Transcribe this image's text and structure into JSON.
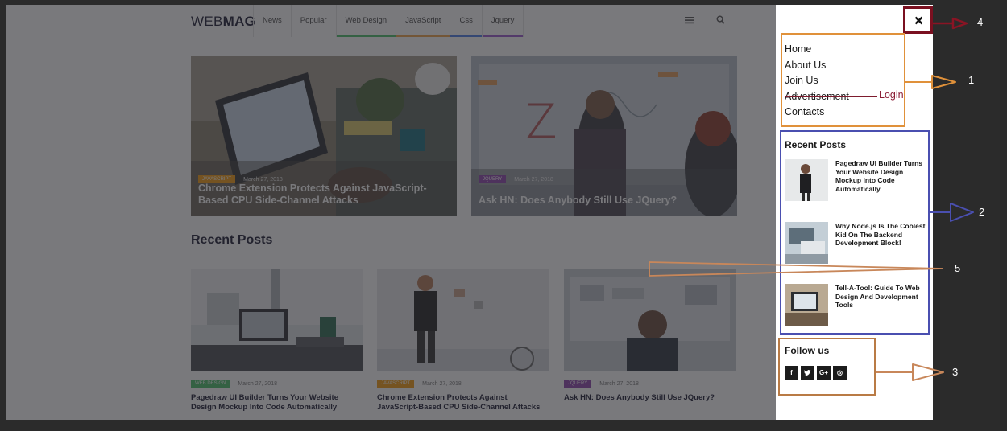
{
  "header": {
    "logo_regular": "WEB",
    "logo_bold": "MAG",
    "nav": [
      {
        "label": "News",
        "color": ""
      },
      {
        "label": "Popular",
        "color": ""
      },
      {
        "label": "Web Design",
        "color": "#4bbf6b"
      },
      {
        "label": "JavaScript",
        "color": "#f0a44a"
      },
      {
        "label": "Css",
        "color": "#4a7de8"
      },
      {
        "label": "Jquery",
        "color": "#9b59d0"
      }
    ],
    "menu_icon": "hamburger-icon",
    "search_icon": "search-icon"
  },
  "hero": [
    {
      "category": "JAVASCRIPT",
      "category_color": "#f39c12",
      "date": "March 27, 2018",
      "title": "Chrome Extension Protects Against JavaScript-Based CPU Side-Channel Attacks"
    },
    {
      "category": "JQUERY",
      "category_color": "#8e44ad",
      "date": "March 27, 2018",
      "title": "Ask HN: Does Anybody Still Use JQuery?"
    }
  ],
  "recent_posts_title": "Recent Posts",
  "cards": [
    {
      "category": "WEB DESIGN",
      "category_color": "#4bbf6b",
      "date": "March 27, 2018",
      "title": "Pagedraw UI Builder Turns Your Website Design Mockup Into Code Automatically"
    },
    {
      "category": "JAVASCRIPT",
      "category_color": "#f39c12",
      "date": "March 27, 2018",
      "title": "Chrome Extension Protects Against JavaScript-Based CPU Side-Channel Attacks"
    },
    {
      "category": "JQUERY",
      "category_color": "#8e44ad",
      "date": "March 27, 2018",
      "title": "Ask HN: Does Anybody Still Use JQuery?"
    }
  ],
  "side_panel": {
    "close_icon": "close-icon",
    "menu": [
      "Home",
      "About Us",
      "Join Us",
      "Advertisement",
      "Contacts"
    ],
    "login_note": "Login",
    "recent_posts_title": "Recent Posts",
    "recent_posts": [
      "Pagedraw UI Builder Turns Your Website Design Mockup Into Code Automatically",
      "Why Node.js Is The Coolest Kid On The Backend Development Block!",
      "Tell-A-Tool: Guide To Web Design And Development Tools"
    ],
    "follow_title": "Follow us",
    "social": [
      {
        "icon": "facebook-icon",
        "glyph": "f"
      },
      {
        "icon": "twitter-icon",
        "glyph": "t"
      },
      {
        "icon": "google-plus-icon",
        "glyph": "G+"
      },
      {
        "icon": "instagram-icon",
        "glyph": "◎"
      }
    ]
  },
  "annotations": {
    "labels": [
      "1",
      "2",
      "3",
      "4",
      "5"
    ],
    "colors": {
      "menu": "#e0913a",
      "recent": "#4a4fb0",
      "follow": "#b97b45",
      "close": "#7a1020",
      "thumbs": "#c8875a"
    }
  }
}
